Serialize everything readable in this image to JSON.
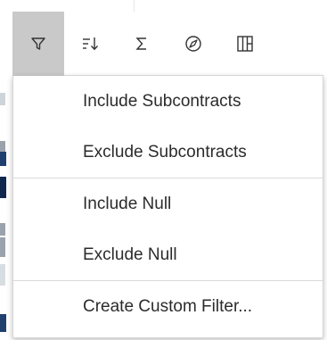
{
  "toolbar": {
    "buttons": [
      {
        "id": "filter",
        "icon": "filter-icon",
        "active": true
      },
      {
        "id": "sort",
        "icon": "sort-icon",
        "active": false
      },
      {
        "id": "summarize",
        "icon": "sigma-icon",
        "active": false
      },
      {
        "id": "navigate",
        "icon": "compass-icon",
        "active": false
      },
      {
        "id": "columns",
        "icon": "table-columns-icon",
        "active": false
      }
    ]
  },
  "menu": {
    "groups": [
      {
        "items": [
          "Include Subcontracts",
          "Exclude Subcontracts"
        ]
      },
      {
        "items": [
          "Include Null",
          "Exclude Null"
        ]
      },
      {
        "items": [
          "Create Custom Filter..."
        ]
      }
    ]
  },
  "colors": {
    "active_button_bg": "#c9c9c9",
    "icon": "#333333",
    "text": "#2b2b2b",
    "divider": "#dadada"
  }
}
